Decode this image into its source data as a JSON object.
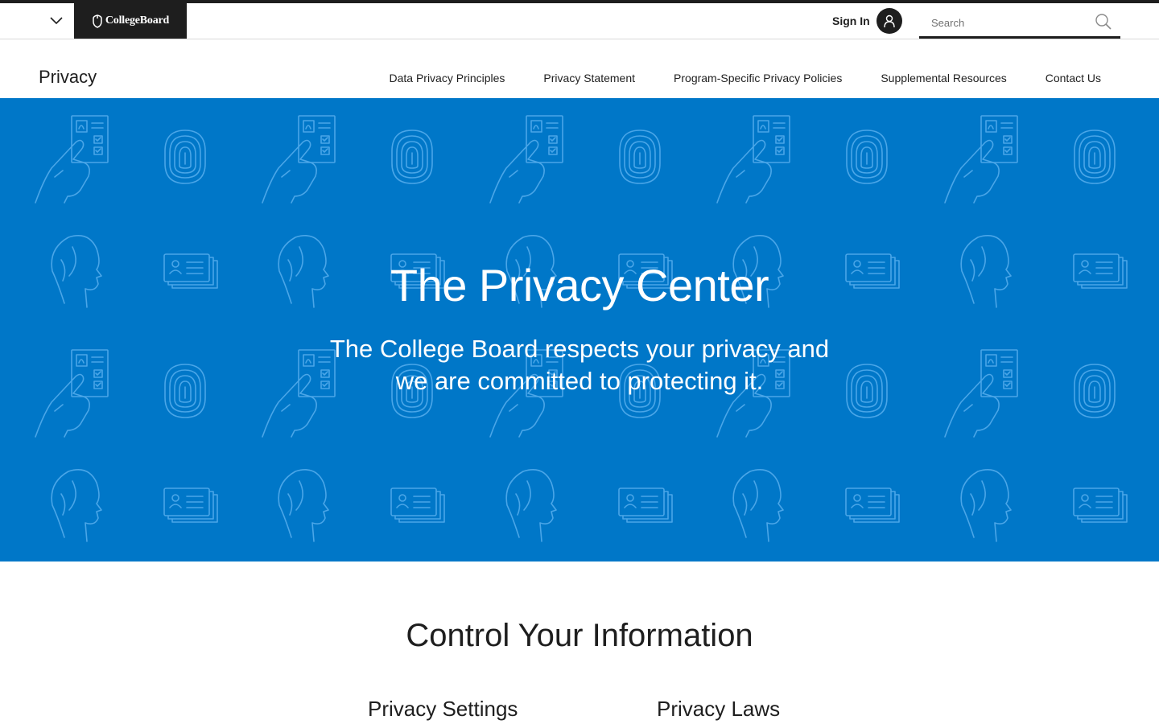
{
  "header": {
    "logo_text": "CollegeBoard",
    "sign_in_label": "Sign In",
    "search_placeholder": "Search"
  },
  "local_nav": {
    "title": "Privacy",
    "links": [
      {
        "label": "Data Privacy Principles"
      },
      {
        "label": "Privacy Statement"
      },
      {
        "label": "Program-Specific Privacy Policies"
      },
      {
        "label": "Supplemental Resources"
      },
      {
        "label": "Contact Us"
      }
    ]
  },
  "hero": {
    "title": "The Privacy Center",
    "subtitle": "The College Board respects your privacy and we are committed to protecting it.",
    "background_color": "#0077c8"
  },
  "main": {
    "section_title": "Control Your Information",
    "cards": [
      {
        "title": "Privacy Settings"
      },
      {
        "title": "Privacy Laws"
      }
    ]
  }
}
